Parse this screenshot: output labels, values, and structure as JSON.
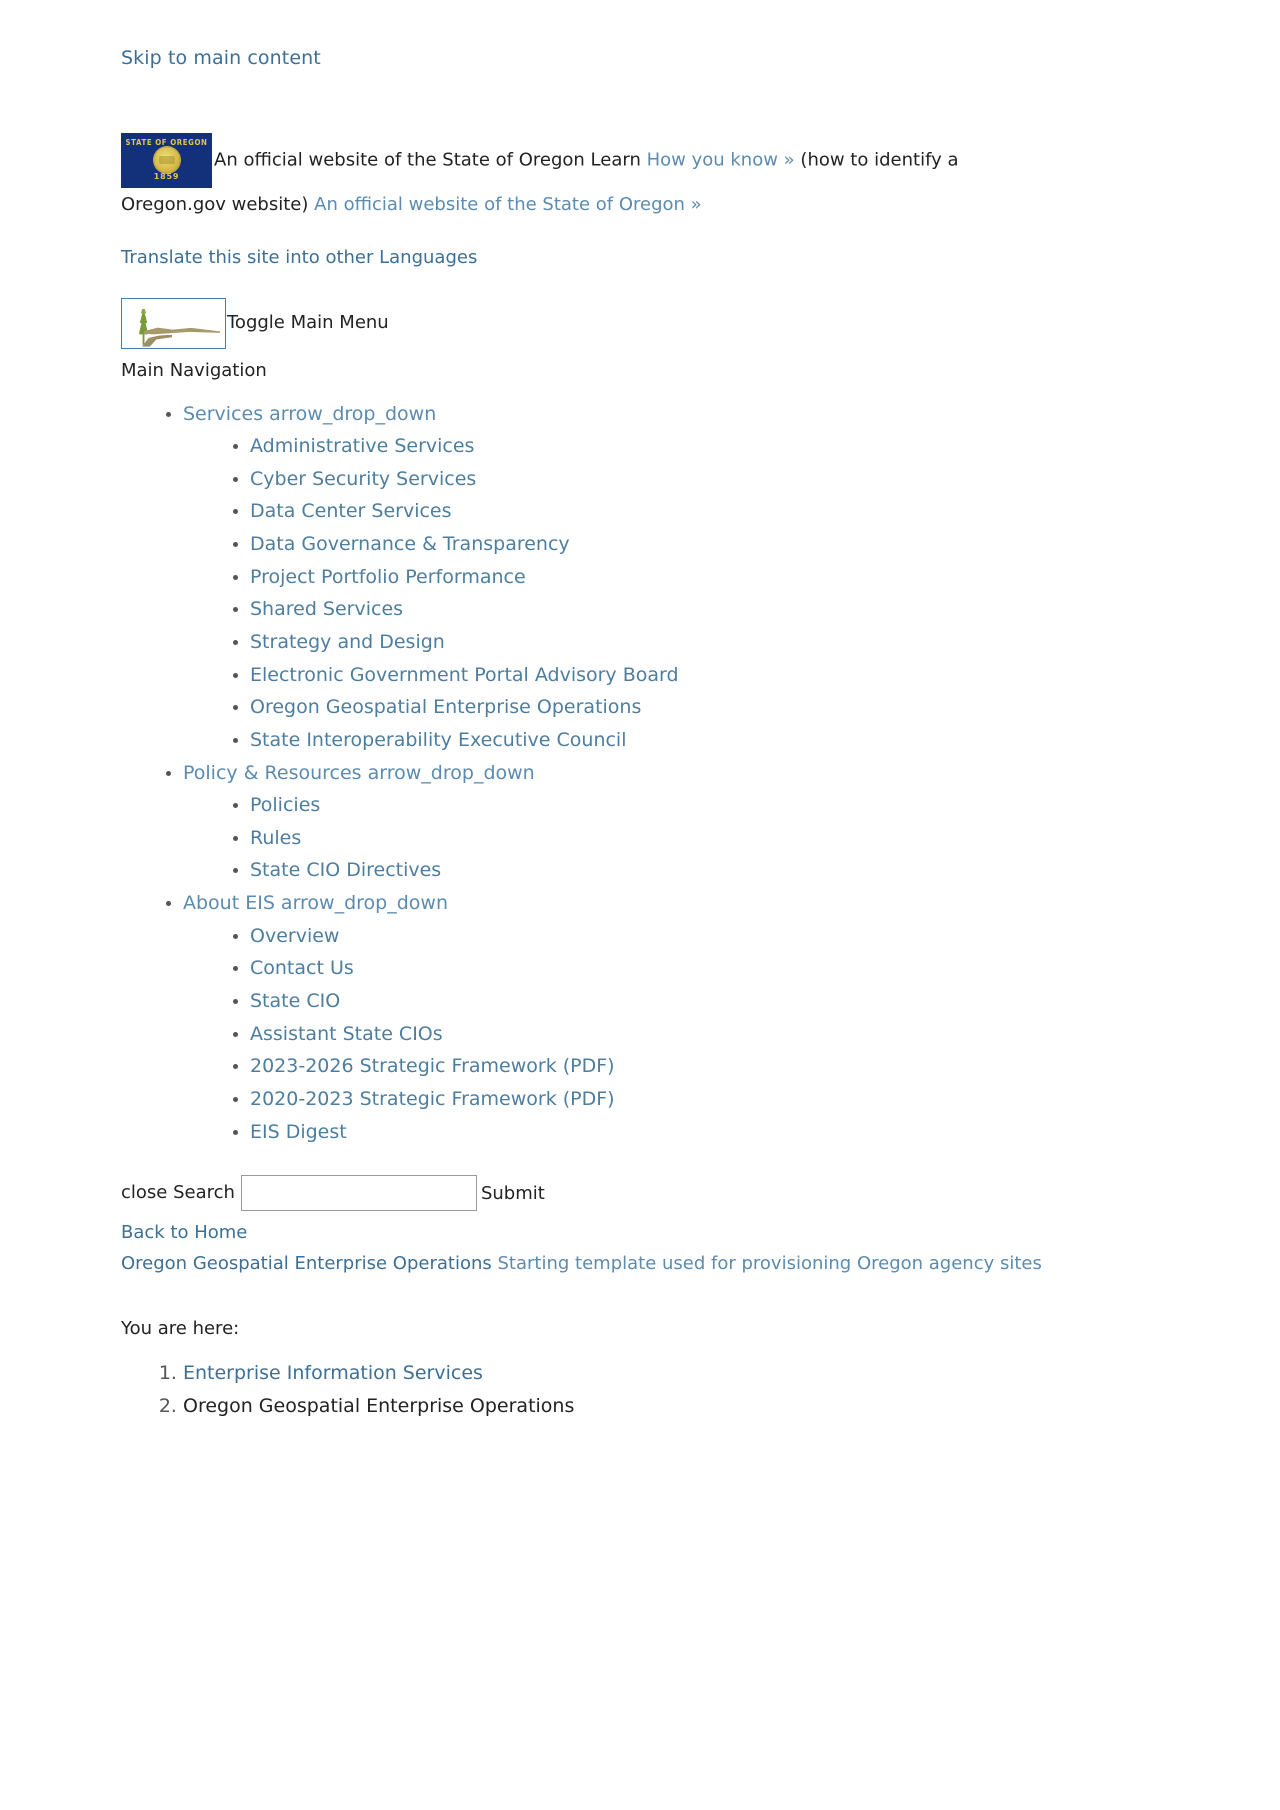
{
  "skip_link": "Skip to main content",
  "banner": {
    "flag_alt": "oregon-state-flag",
    "flag_title": "STATE OF OREGON",
    "flag_year": "1859",
    "text_before": "An official website of the State of Oregon Learn",
    "how_you_know_link": "How you know »",
    "text_middle": "(how to identify a Oregon.gov website)",
    "official_site_link": "An official website of the State of Oregon »"
  },
  "translate_link": "Translate this site into other Languages",
  "logo": {
    "alt": "oregon-eis-logo",
    "toggle_label": "Toggle Main Menu"
  },
  "main_navigation_title": "Main Navigation",
  "nav": [
    {
      "label": "Services arrow_drop_down",
      "children": [
        "Administrative Services",
        "Cyber Security Services",
        "Data Center Services",
        "Data Governance & Transparency",
        "Project Portfolio Performance",
        "Shared Services",
        "Strategy and Design",
        "Electronic Government Portal Advisory Board",
        "Oregon Geospatial Enterprise Operations",
        "State Interoperability Executive Council"
      ]
    },
    {
      "label": "Policy & Resources arrow_drop_down",
      "children": [
        "Policies",
        "Rules",
        "State CIO Directives"
      ]
    },
    {
      "label": "About EIS arrow_drop_down",
      "children": [
        "Overview",
        "Contact Us",
        "State CIO",
        "Assistant State CIOs",
        "2023-2026 Strategic Framework (PDF)",
        "2020-2023 Strategic Framework (PDF)",
        "EIS Digest"
      ]
    }
  ],
  "search": {
    "close_label": "close Search",
    "value": "",
    "placeholder": "",
    "submit_label": "Submit"
  },
  "back_to_home": "Back to Home",
  "site_title": "Oregon Geospatial Enterprise Operations",
  "site_tagline": " Starting template used for provisioning Oregon agency sites",
  "you_are_here_label": "You are here:",
  "breadcrumb": [
    {
      "label": "Enterprise Information Services",
      "is_link": true
    },
    {
      "label": "Oregon Geospatial Enterprise Operations",
      "is_link": false
    }
  ]
}
